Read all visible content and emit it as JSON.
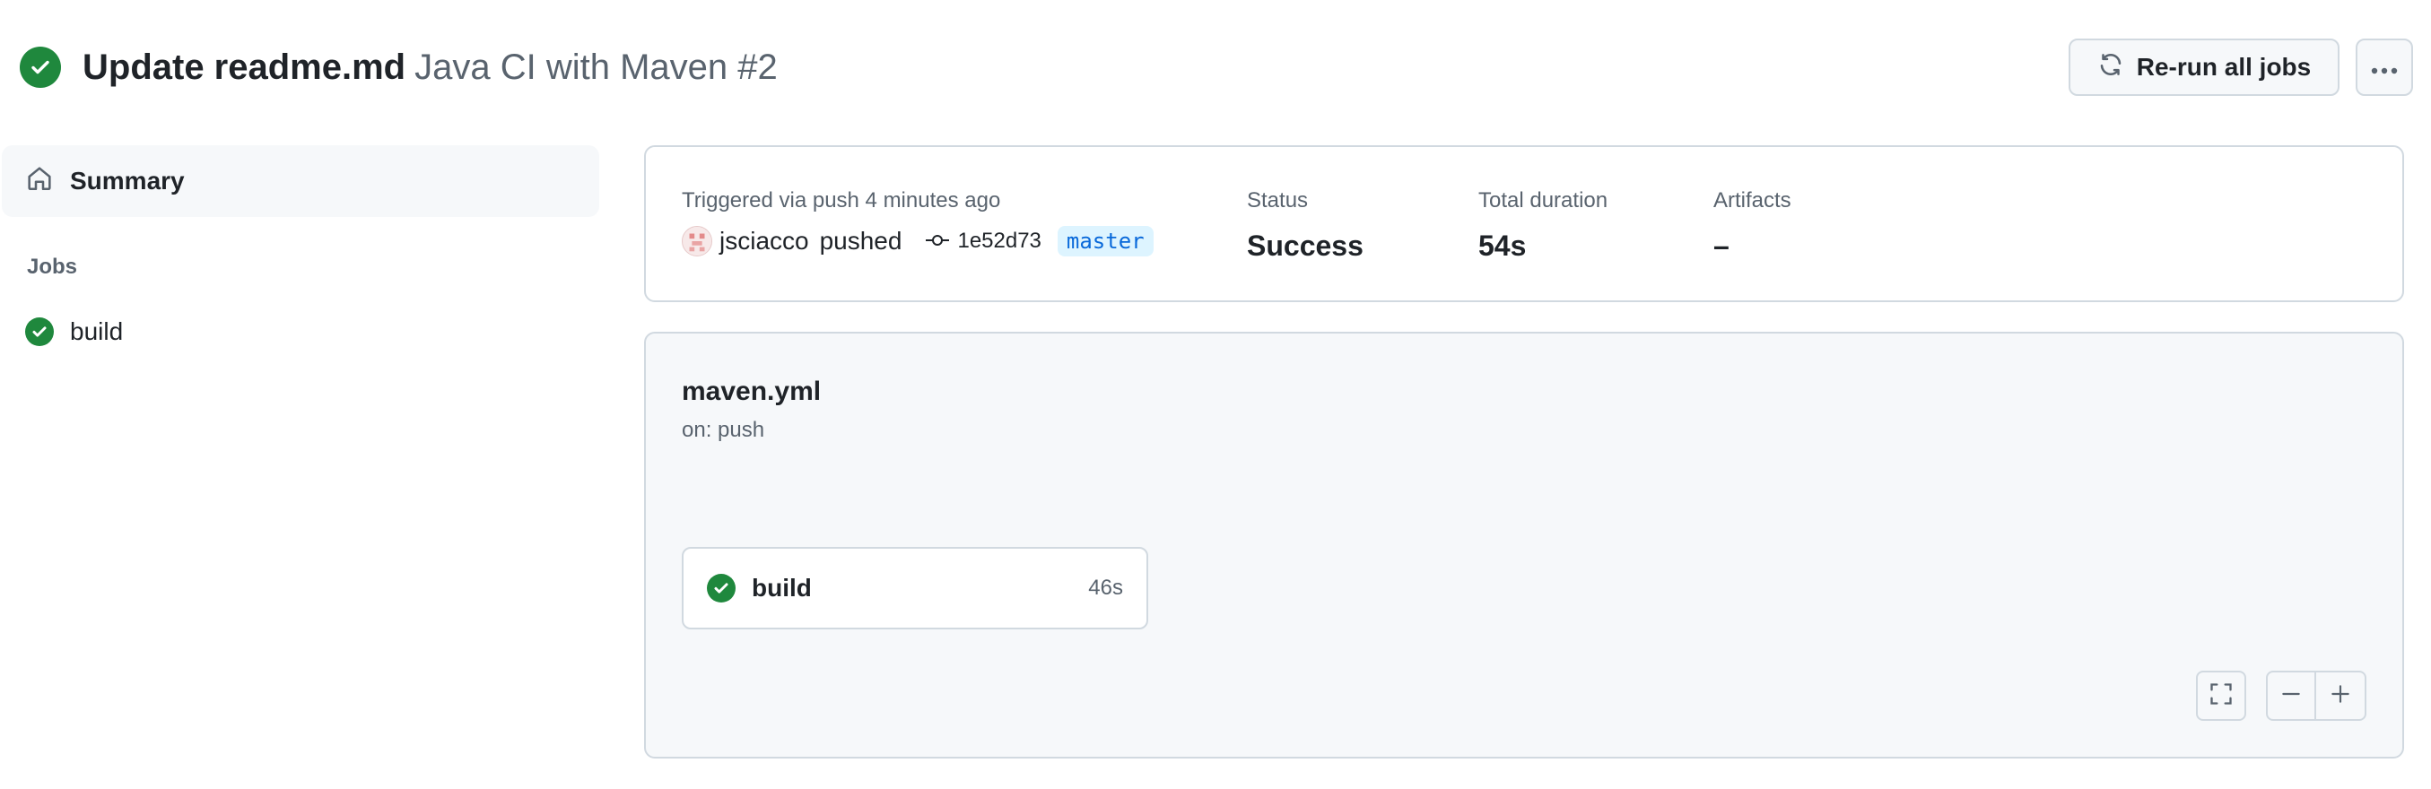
{
  "header": {
    "title": "Update readme.md",
    "workflow_label": "Java CI with Maven #2",
    "rerun_label": "Re-run all jobs",
    "status_icon": "check-circle-fill-icon"
  },
  "sidebar": {
    "summary_label": "Summary",
    "jobs_heading": "Jobs",
    "jobs": [
      {
        "label": "build",
        "status": "success"
      }
    ]
  },
  "summary": {
    "trigger_text": "Triggered via push 4 minutes ago",
    "actor": "jsciacco",
    "action": "pushed",
    "commit": "1e52d73",
    "branch": "master",
    "status_label": "Status",
    "status_value": "Success",
    "duration_label": "Total duration",
    "duration_value": "54s",
    "artifacts_label": "Artifacts",
    "artifacts_value": "–"
  },
  "graph": {
    "workflow_file": "maven.yml",
    "trigger": "on: push",
    "job": {
      "name": "build",
      "duration": "46s",
      "status": "success"
    }
  },
  "colors": {
    "success": "#1f883d",
    "border": "#d1d9e0",
    "muted_text": "#59636e",
    "branch_bg": "#ddf4ff",
    "branch_text": "#0969da"
  }
}
